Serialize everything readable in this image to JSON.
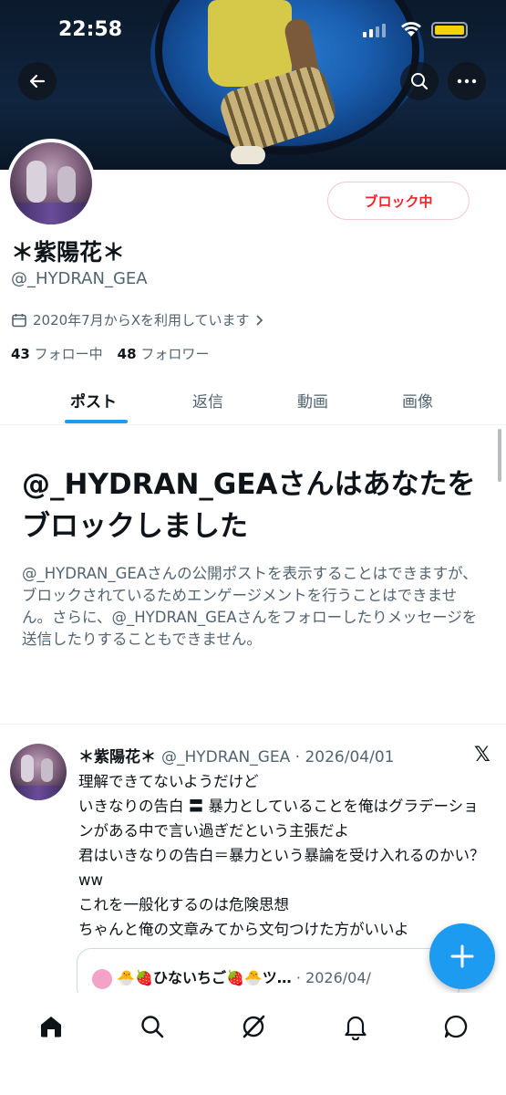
{
  "status_bar": {
    "time": "22:58"
  },
  "profile": {
    "block_button": "ブロック中",
    "display_name": "＊紫陽花＊",
    "handle": "@_HYDRAN_GEA",
    "joined": "2020年7月からXを利用しています",
    "following_count": "43",
    "following_label": "フォロー中",
    "followers_count": "48",
    "followers_label": "フォロワー"
  },
  "tabs": [
    "ポスト",
    "返信",
    "動画",
    "画像"
  ],
  "blocked": {
    "title": "@_HYDRAN_GEAさんはあなたをブロックしました",
    "description": "@_HYDRAN_GEAさんの公開ポストを表示することはできますが、ブロックされているためエンゲージメントを行うことはできません。さらに、@_HYDRAN_GEAさんをフォローしたりメッセージを送信したりすることもできません。"
  },
  "tweet": {
    "name": "＊紫陽花＊",
    "handle_date": "@_HYDRAN_GEA · 2026/04/01",
    "lines": [
      "理解できてないようだけど",
      "いきなりの告白 〓 暴力としていることを俺はグラデーションがある中で言い過ぎだという主張だよ",
      "君はいきなりの告白＝暴力という暴論を受け入れるのかい？ww",
      "これを一般化するのは危険思想",
      "ちゃんと俺の文章みてから文句つけた方がいいよ"
    ],
    "quote_name": "🐣🍓ひないちご🍓🐣ツ…",
    "quote_date": "· 2026/04/"
  },
  "icons": {
    "back": "back-arrow-icon",
    "search": "search-icon",
    "more": "more-icon",
    "calendar": "calendar-icon",
    "x": "x-logo-icon",
    "home": "home-icon",
    "grok": "grok-icon",
    "bell": "bell-icon",
    "messages": "messages-icon"
  },
  "colors": {
    "accent": "#1d9bf0",
    "block": "#f4212e"
  }
}
